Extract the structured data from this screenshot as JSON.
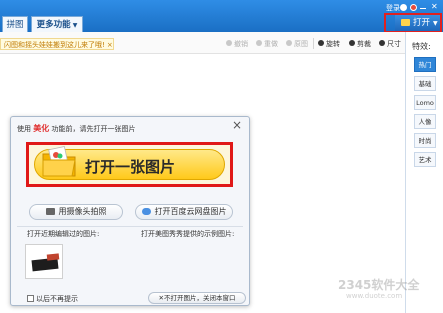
{
  "topbar": {
    "tab_collage": "拼图",
    "tab_more": "更多功能",
    "login": "登录",
    "open_label": "打开"
  },
  "toolbar": {
    "notice": "闪图和摇头娃娃搬到这儿来了哦!",
    "notice_close": "×",
    "undo": "撤销",
    "redo": "重做",
    "original": "原图",
    "rotate": "旋转",
    "crop": "剪裁",
    "size": "尺寸"
  },
  "right_panel": {
    "title": "特效:",
    "items": [
      "热门",
      "基础",
      "Lomo",
      "人像",
      "时尚",
      "艺术"
    ],
    "active_index": 0
  },
  "dialog": {
    "head_prefix": "使用",
    "head_brand": "美化",
    "head_suffix": "功能前，请先打开一张图片",
    "close": "×",
    "open_big": "打开一张图片",
    "camera_btn": "用摄像头拍照",
    "cloud_btn": "打开百度云网盘图片",
    "recent_label": "打开近期编辑过的图片:",
    "sample_label": "打开美图秀秀提供的示例图片:",
    "dont_show": "以后不再提示",
    "no_open_btn": "不打开图片，关闭本窗口"
  },
  "watermark": {
    "line1": "2345软件大全",
    "line2": "www.duote.com"
  }
}
